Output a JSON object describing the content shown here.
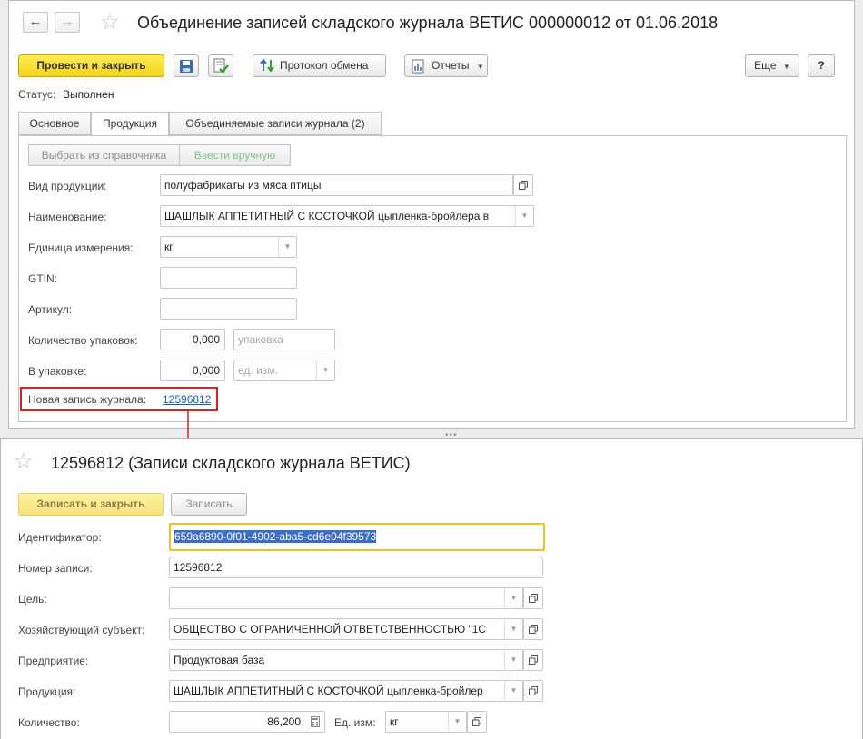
{
  "window1": {
    "title": "Объединение записей складского журнала ВЕТИС 000000012 от 01.06.2018",
    "toolbar": {
      "post_close": "Провести и закрыть",
      "exchange_log": "Протокол обмена",
      "reports": "Отчеты",
      "more": "Еще",
      "help": "?"
    },
    "status_label": "Статус:",
    "status_value": "Выполнен",
    "tabs": [
      {
        "label": "Основное"
      },
      {
        "label": "Продукция"
      },
      {
        "label": "Объединяемые записи журнала (2)"
      }
    ],
    "segments": {
      "from_catalog": "Выбрать из справочника",
      "manual": "Ввести вручную"
    },
    "form": {
      "product_type_label": "Вид продукции:",
      "product_type_value": "полуфабрикаты из мяса птицы",
      "name_label": "Наименование:",
      "name_value": "ШАШЛЫК АППЕТИТНЫЙ С КОСТОЧКОЙ цыпленка-бройлера в",
      "unit_label": "Единица измерения:",
      "unit_value": "кг",
      "gtin_label": "GTIN:",
      "article_label": "Артикул:",
      "pack_count_label": "Количество упаковок:",
      "pack_count_value": "0,000",
      "pack_placeholder": "упаковка",
      "in_pack_label": "В упаковке:",
      "in_pack_value": "0,000",
      "unit_placeholder": "ед. изм.",
      "new_record_label": "Новая запись журнала:",
      "new_record_link": "12596812"
    }
  },
  "window2": {
    "title": "12596812 (Записи складского журнала ВЕТИС)",
    "toolbar": {
      "save_close": "Записать и закрыть",
      "save": "Записать"
    },
    "form": {
      "id_label": "Идентификатор:",
      "id_value": "659a6890-0f01-4902-aba5-cd6e04f39573",
      "number_label": "Номер записи:",
      "number_value": "12596812",
      "goal_label": "Цель:",
      "goal_value": "",
      "entity_label": "Хозяйствующий субъект:",
      "entity_value": "ОБЩЕСТВО С ОГРАНИЧЕННОЙ ОТВЕТСТВЕННОСТЬЮ \"1С",
      "enterprise_label": "Предприятие:",
      "enterprise_value": "Продуктовая база",
      "product_label": "Продукция:",
      "product_value": "ШАШЛЫК АППЕТИТНЫЙ С КОСТОЧКОЙ цыпленка-бройлер",
      "qty_label": "Количество:",
      "qty_value": "86,200",
      "uom_label": "Ед. изм:",
      "uom_value": "кг"
    }
  },
  "colors": {
    "primary_button": "#f4d21b",
    "link": "#185fa9",
    "highlight_frame": "#e02020",
    "focus_frame": "#e8c22a",
    "selection": "#3b6fc4"
  }
}
